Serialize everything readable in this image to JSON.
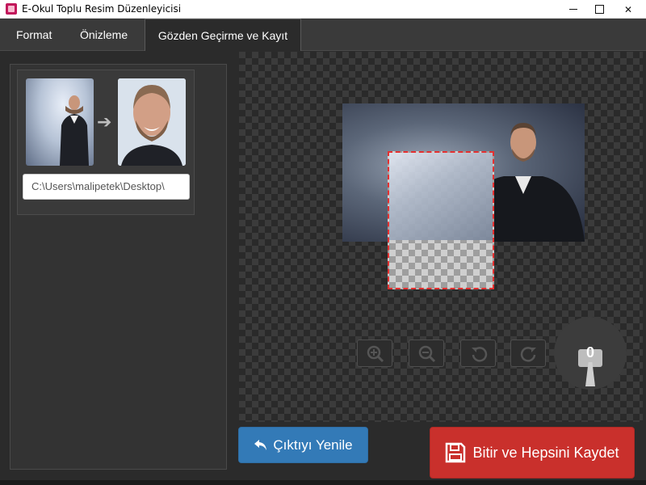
{
  "window": {
    "title": "E-Okul Toplu Resim Düzenleyicisi",
    "minimize_icon": "minimize-icon",
    "maximize_icon": "maximize-icon",
    "close_icon": "close-icon",
    "close_glyph": "✕"
  },
  "tabs": [
    {
      "label": "Format",
      "active": false
    },
    {
      "label": "Önizleme",
      "active": false
    },
    {
      "label": "Gözden Geçirme ve Kayıt",
      "active": true
    }
  ],
  "left_panel": {
    "item": {
      "arrow_glyph": "➔",
      "path_value": "C:\\Users\\malipetek\\Desktop\\"
    }
  },
  "editor": {
    "rotation_value": "0",
    "tools": [
      "zoom-in-icon",
      "zoom-out-icon",
      "rotate-left-icon",
      "rotate-right-icon"
    ]
  },
  "actions": {
    "refresh_label": "Çıktıyı Yenile",
    "save_label": "Bitir ve Hepsini Kaydet"
  },
  "colors": {
    "accent_blue": "#337ab7",
    "save_red": "#c9302c",
    "crop_border": "#e53030"
  }
}
